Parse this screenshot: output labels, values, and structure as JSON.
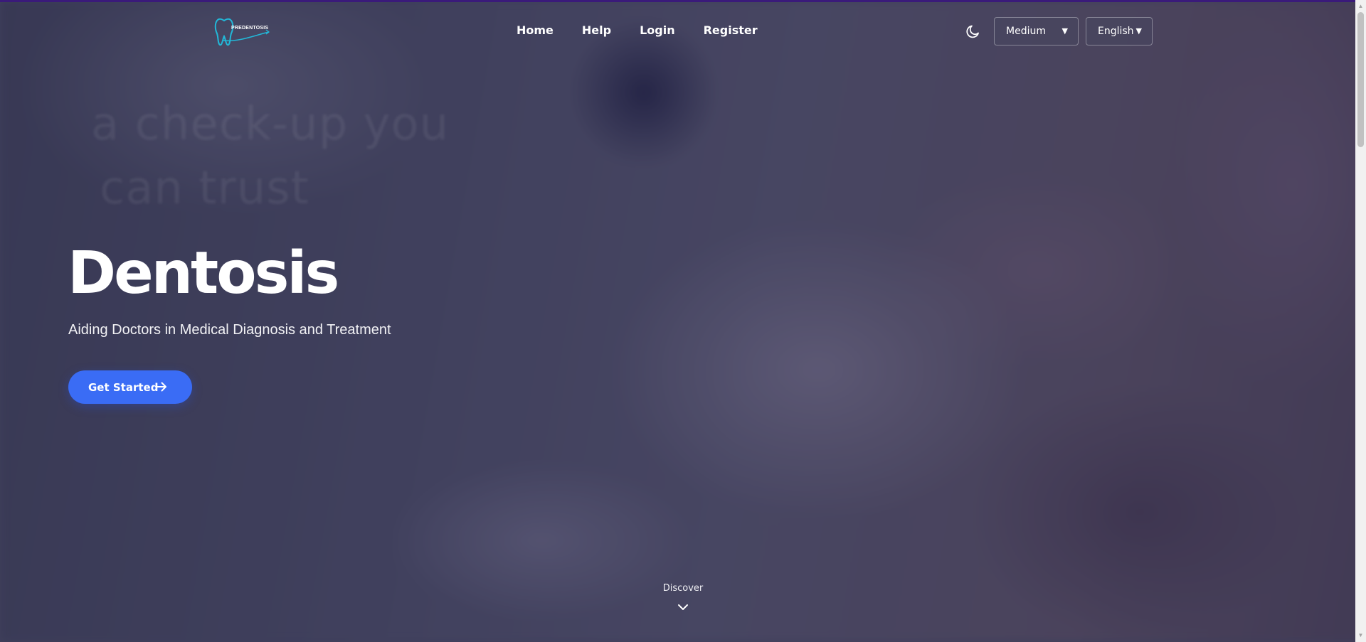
{
  "header": {
    "logo_text": "PREDENTOSIS",
    "nav": {
      "home": "Home",
      "help": "Help",
      "login": "Login",
      "register": "Register"
    },
    "theme_icon": "moon-icon",
    "text_size_select": {
      "value": "Medium",
      "caret": "▼"
    },
    "language_select": {
      "value": "English",
      "caret": "▼"
    }
  },
  "hero": {
    "ghost_line_1": "a check-up you",
    "ghost_line_2": "can trust",
    "title": "Dentosis",
    "subtitle": "Aiding Doctors in Medical Diagnosis and Treatment",
    "cta_label": "Get Started",
    "cta_icon": "arrow-right-icon",
    "discover_label": "Discover",
    "discover_icon": "chevron-down-icon"
  },
  "colors": {
    "accent": "#3a6cf5",
    "logo_teal": "#22b8d8",
    "top_bar": "#3a1a7a"
  },
  "scrollbar": {
    "up": "▲",
    "down": "▼"
  }
}
